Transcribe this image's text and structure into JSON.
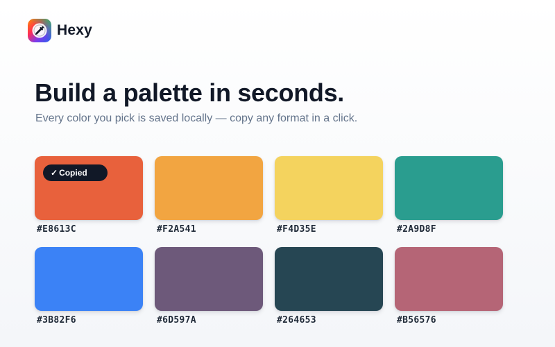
{
  "app": {
    "name": "Hexy",
    "logo_icon": "color-picker-eyedropper-icon"
  },
  "hero": {
    "title": "Build a palette in seconds.",
    "subtitle": "Every color you pick is saved locally — copy any format in a click."
  },
  "palette": {
    "swatches": [
      {
        "hex": "#E8613C",
        "copied": true
      },
      {
        "hex": "#F2A541",
        "copied": false
      },
      {
        "hex": "#F4D35E",
        "copied": false
      },
      {
        "hex": "#2A9D8F",
        "copied": false
      },
      {
        "hex": "#3B82F6",
        "copied": false
      },
      {
        "hex": "#6D597A",
        "copied": false
      },
      {
        "hex": "#264653",
        "copied": false
      },
      {
        "hex": "#B56576",
        "copied": false
      }
    ],
    "copied_badge": {
      "check": "✓",
      "label": "Copied"
    }
  }
}
